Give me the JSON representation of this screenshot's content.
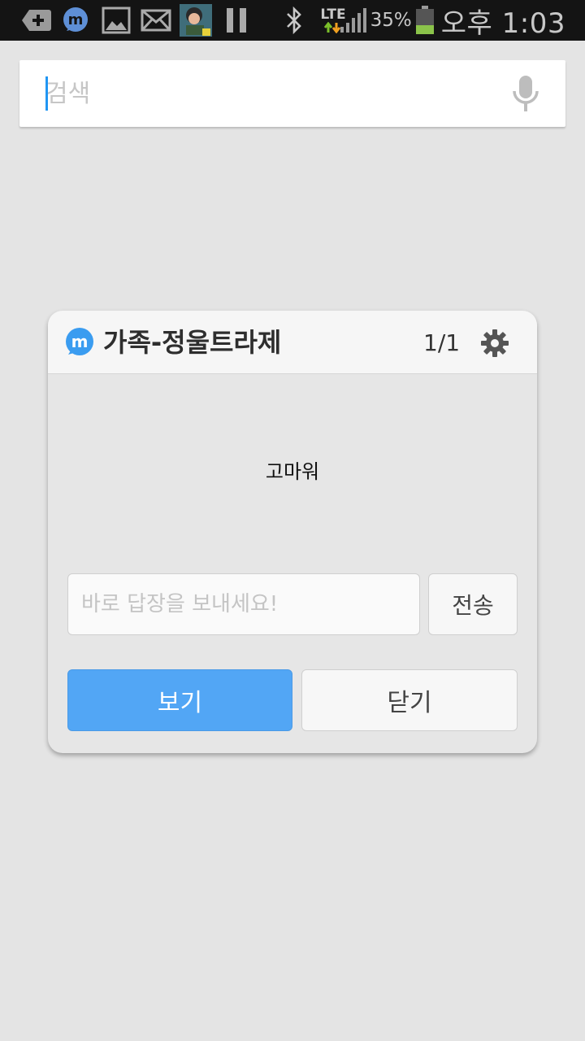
{
  "status_bar": {
    "icons": [
      "add-notification-icon",
      "mypeople-icon",
      "image-icon",
      "mail-icon",
      "game-avatar-icon",
      "pause-icon",
      "bluetooth-icon",
      "lte-data-icon",
      "signal-icon",
      "battery-icon"
    ],
    "network": "LTE",
    "battery_percent": "35%",
    "time": "오후 1:03"
  },
  "search": {
    "placeholder": "검색",
    "value": ""
  },
  "popup": {
    "title": "가족-정울트라제",
    "counter": "1/1",
    "message": "고마워",
    "reply_placeholder": "바로 답장을 보내세요!",
    "send_label": "전송",
    "view_label": "보기",
    "close_label": "닫기"
  },
  "colors": {
    "accent": "#52a6f5",
    "background": "#e4e4e4",
    "status_bar": "#141414",
    "battery_level": "#8bc34a"
  }
}
